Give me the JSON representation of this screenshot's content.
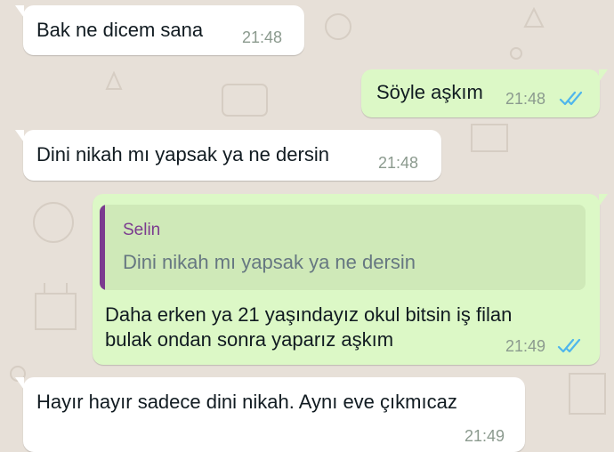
{
  "colors": {
    "wallpaper": "#e7e0d8",
    "incoming_bubble": "#ffffff",
    "outgoing_bubble": "#dcf8c6",
    "read_ticks": "#4fb6ec",
    "quote_author": "#7b3b8f"
  },
  "messages": [
    {
      "direction": "in",
      "text": "Bak ne dicem sana",
      "time": "21:48"
    },
    {
      "direction": "out",
      "text": "Söyle aşkım",
      "time": "21:48",
      "status_icon": "double-check-icon"
    },
    {
      "direction": "in",
      "text": "Dini nikah mı yapsak ya ne dersin",
      "time": "21:48"
    },
    {
      "direction": "out",
      "quote": {
        "author": "Selin",
        "text": "Dini nikah mı yapsak ya ne dersin"
      },
      "lines": [
        "Daha erken ya 21 yaşındayız okul bitsin iş filan",
        "bulak ondan sonra yaparız aşkım"
      ],
      "time": "21:49",
      "status_icon": "double-check-icon"
    },
    {
      "direction": "in",
      "text": "Hayır hayır sadece dini nikah. Aynı eve çıkmıcaz",
      "time": "21:49"
    }
  ]
}
